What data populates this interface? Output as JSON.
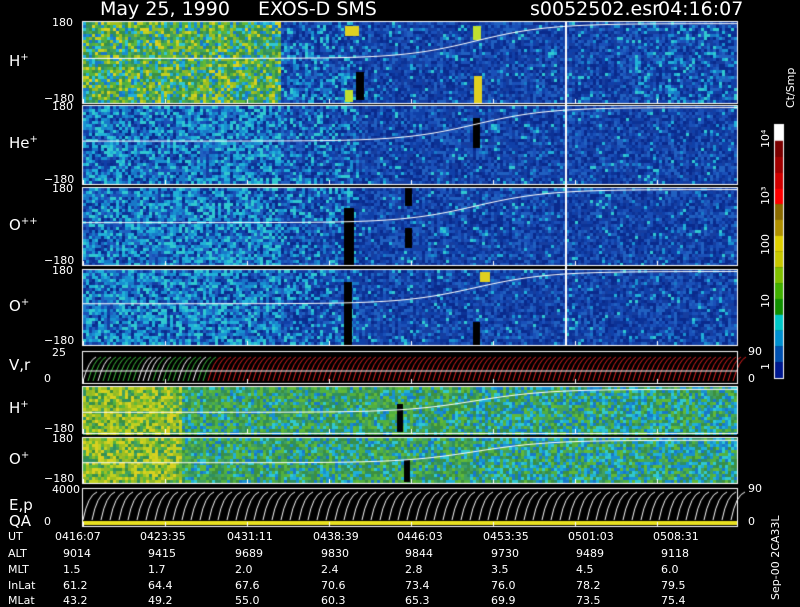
{
  "header": {
    "date": "May 25, 1990",
    "instrument": "EXOS-D SMS",
    "file": "s0052502.esr",
    "time": "04:16:07"
  },
  "panels": [
    {
      "label": "H",
      "sup": "+",
      "ytop": "180",
      "ybot": "−180",
      "kind": "spectrogram"
    },
    {
      "label": "He",
      "sup": "+",
      "ytop": "180",
      "ybot": "−180",
      "kind": "spectrogram"
    },
    {
      "label": "O",
      "sup": "++",
      "ytop": "180",
      "ybot": "−180",
      "kind": "spectrogram"
    },
    {
      "label": "O",
      "sup": "+",
      "ytop": "180",
      "ybot": "−180",
      "kind": "spectrogram"
    },
    {
      "label": "V,r",
      "sup": "",
      "ytop": "25",
      "ybot": "0",
      "right_top": "90",
      "right_bot": "0",
      "kind": "lines"
    },
    {
      "label": "H",
      "sup": "+",
      "ytop": "",
      "ybot": "−180",
      "kind": "spectrogram"
    },
    {
      "label": "O",
      "sup": "+",
      "ytop": "180",
      "ybot": "−180",
      "kind": "spectrogram"
    },
    {
      "label": "E,p",
      "label2": "QA",
      "sup": "",
      "ytop": "4000",
      "ybot": "0",
      "right_top": "90",
      "right_bot": "0",
      "kind": "lines"
    }
  ],
  "colorbar": {
    "unit": "Ct/Smp",
    "ticks": [
      "10⁴",
      "10³",
      "100",
      "10",
      "1"
    ],
    "colors": [
      "#ffffff",
      "#7a0000",
      "#a00000",
      "#d00000",
      "#ff0000",
      "#8a6a00",
      "#b09000",
      "#e0d000",
      "#c8c800",
      "#80c000",
      "#40b000",
      "#109000",
      "#00c8c8",
      "#0090d0",
      "#0050b0",
      "#001890"
    ]
  },
  "footer": {
    "row_labels": [
      "UT",
      "ALT",
      "MLT",
      "InLat",
      "MLat"
    ],
    "columns": [
      {
        "UT": "0416:07",
        "ALT": "9014",
        "MLT": "1.5",
        "InLat": "61.2",
        "MLat": "43.2"
      },
      {
        "UT": "0423:35",
        "ALT": "9415",
        "MLT": "1.7",
        "InLat": "64.4",
        "MLat": "49.2"
      },
      {
        "UT": "0431:11",
        "ALT": "9689",
        "MLT": "2.0",
        "InLat": "67.6",
        "MLat": "55.0"
      },
      {
        "UT": "0438:39",
        "ALT": "9830",
        "MLT": "2.4",
        "InLat": "70.6",
        "MLat": "60.3"
      },
      {
        "UT": "0446:03",
        "ALT": "9844",
        "MLT": "2.8",
        "InLat": "73.4",
        "MLat": "65.3"
      },
      {
        "UT": "0453:35",
        "ALT": "9730",
        "MLT": "3.5",
        "InLat": "76.0",
        "MLat": "69.9"
      },
      {
        "UT": "0501:03",
        "ALT": "9489",
        "MLT": "4.5",
        "InLat": "78.2",
        "MLat": "73.5"
      },
      {
        "UT": "0508:31",
        "ALT": "9118",
        "MLT": "6.0",
        "InLat": "79.5",
        "MLat": "75.4"
      }
    ]
  },
  "side_note": "Sep-00 2CA33L",
  "chart_data": {
    "type": "heatmap",
    "title": "May 25, 1990   EXOS-D SMS",
    "x_ticks": [
      "0416:07",
      "0423:35",
      "0431:11",
      "0438:39",
      "0446:03",
      "0453:35",
      "0501:03",
      "0508:31"
    ],
    "ut_range": [
      "0416:07",
      "0512:00"
    ],
    "y_range_pitch": [
      -180,
      180
    ],
    "colorbar_range_ct_smp": [
      1,
      10000
    ],
    "colorbar_scale": "log",
    "series": [
      {
        "name": "H+"
      },
      {
        "name": "He+"
      },
      {
        "name": "O++"
      },
      {
        "name": "O+"
      },
      {
        "name": "V,r"
      },
      {
        "name": "H+"
      },
      {
        "name": "O+"
      },
      {
        "name": "E,p"
      }
    ],
    "notes": [
      "QA"
    ]
  }
}
